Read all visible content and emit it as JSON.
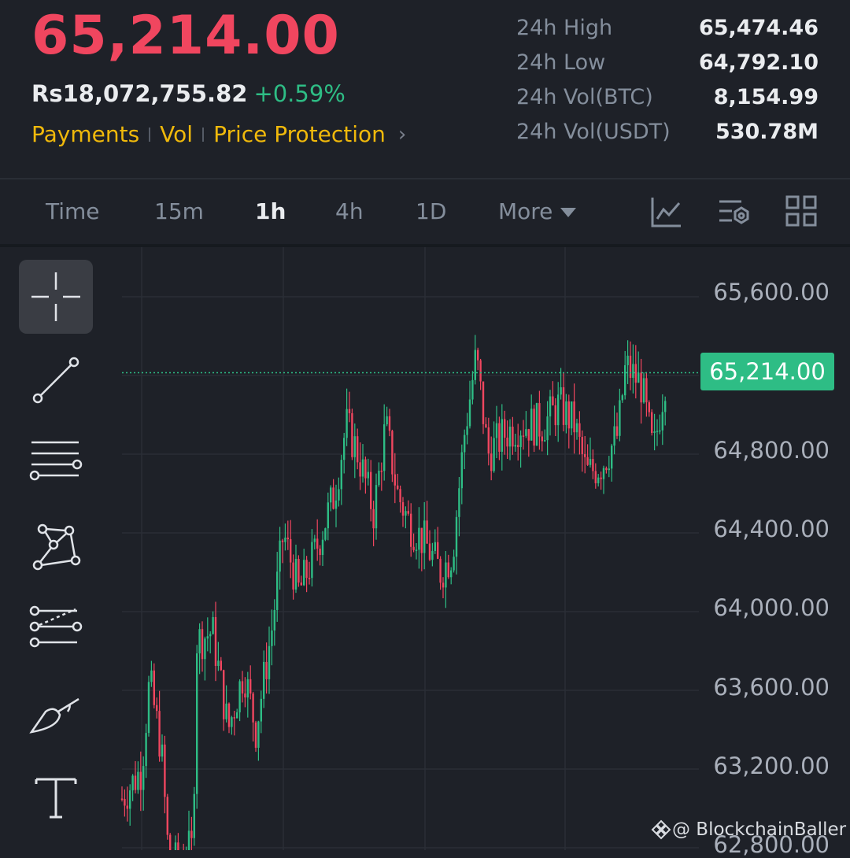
{
  "ticker": {
    "last_price": "65,214.00",
    "fiat_value": "Rs18,072,755.82",
    "change_pct": "+0.59%",
    "links": [
      "Payments",
      "Vol",
      "Price Protection"
    ]
  },
  "stats": [
    {
      "label": "24h High",
      "value": "65,474.46"
    },
    {
      "label": "24h Low",
      "value": "64,792.10"
    },
    {
      "label": "24h Vol(BTC)",
      "value": "8,154.99"
    },
    {
      "label": "24h Vol(USDT)",
      "value": "530.78M"
    }
  ],
  "timeframes": {
    "items": [
      "Time",
      "15m",
      "1h",
      "4h",
      "1D"
    ],
    "active": "1h",
    "more_label": "More"
  },
  "toolbar_icons": [
    "indicator-chart-icon",
    "chart-settings-icon",
    "layout-grid-icon"
  ],
  "drawing_tools": [
    "crosshair-icon",
    "trend-line-icon",
    "horizontal-lines-icon",
    "pattern-icon",
    "fib-channel-icon",
    "brush-icon",
    "text-tool-icon"
  ],
  "chart_data": {
    "type": "candlestick",
    "y_axis_ticks": [
      "65,600.00",
      "64,800.00",
      "64,400.00",
      "64,000.00",
      "63,600.00",
      "63,200.00",
      "62,800.00"
    ],
    "ylim": [
      62800,
      65600
    ],
    "last_price_tag": "65,214.00",
    "colors": {
      "up": "#2ebd85",
      "down": "#f0465f",
      "grid": "#2a2e36",
      "price_line": "#2ebd85"
    },
    "grid": true
  },
  "watermark": "@ BlockchainBaller"
}
